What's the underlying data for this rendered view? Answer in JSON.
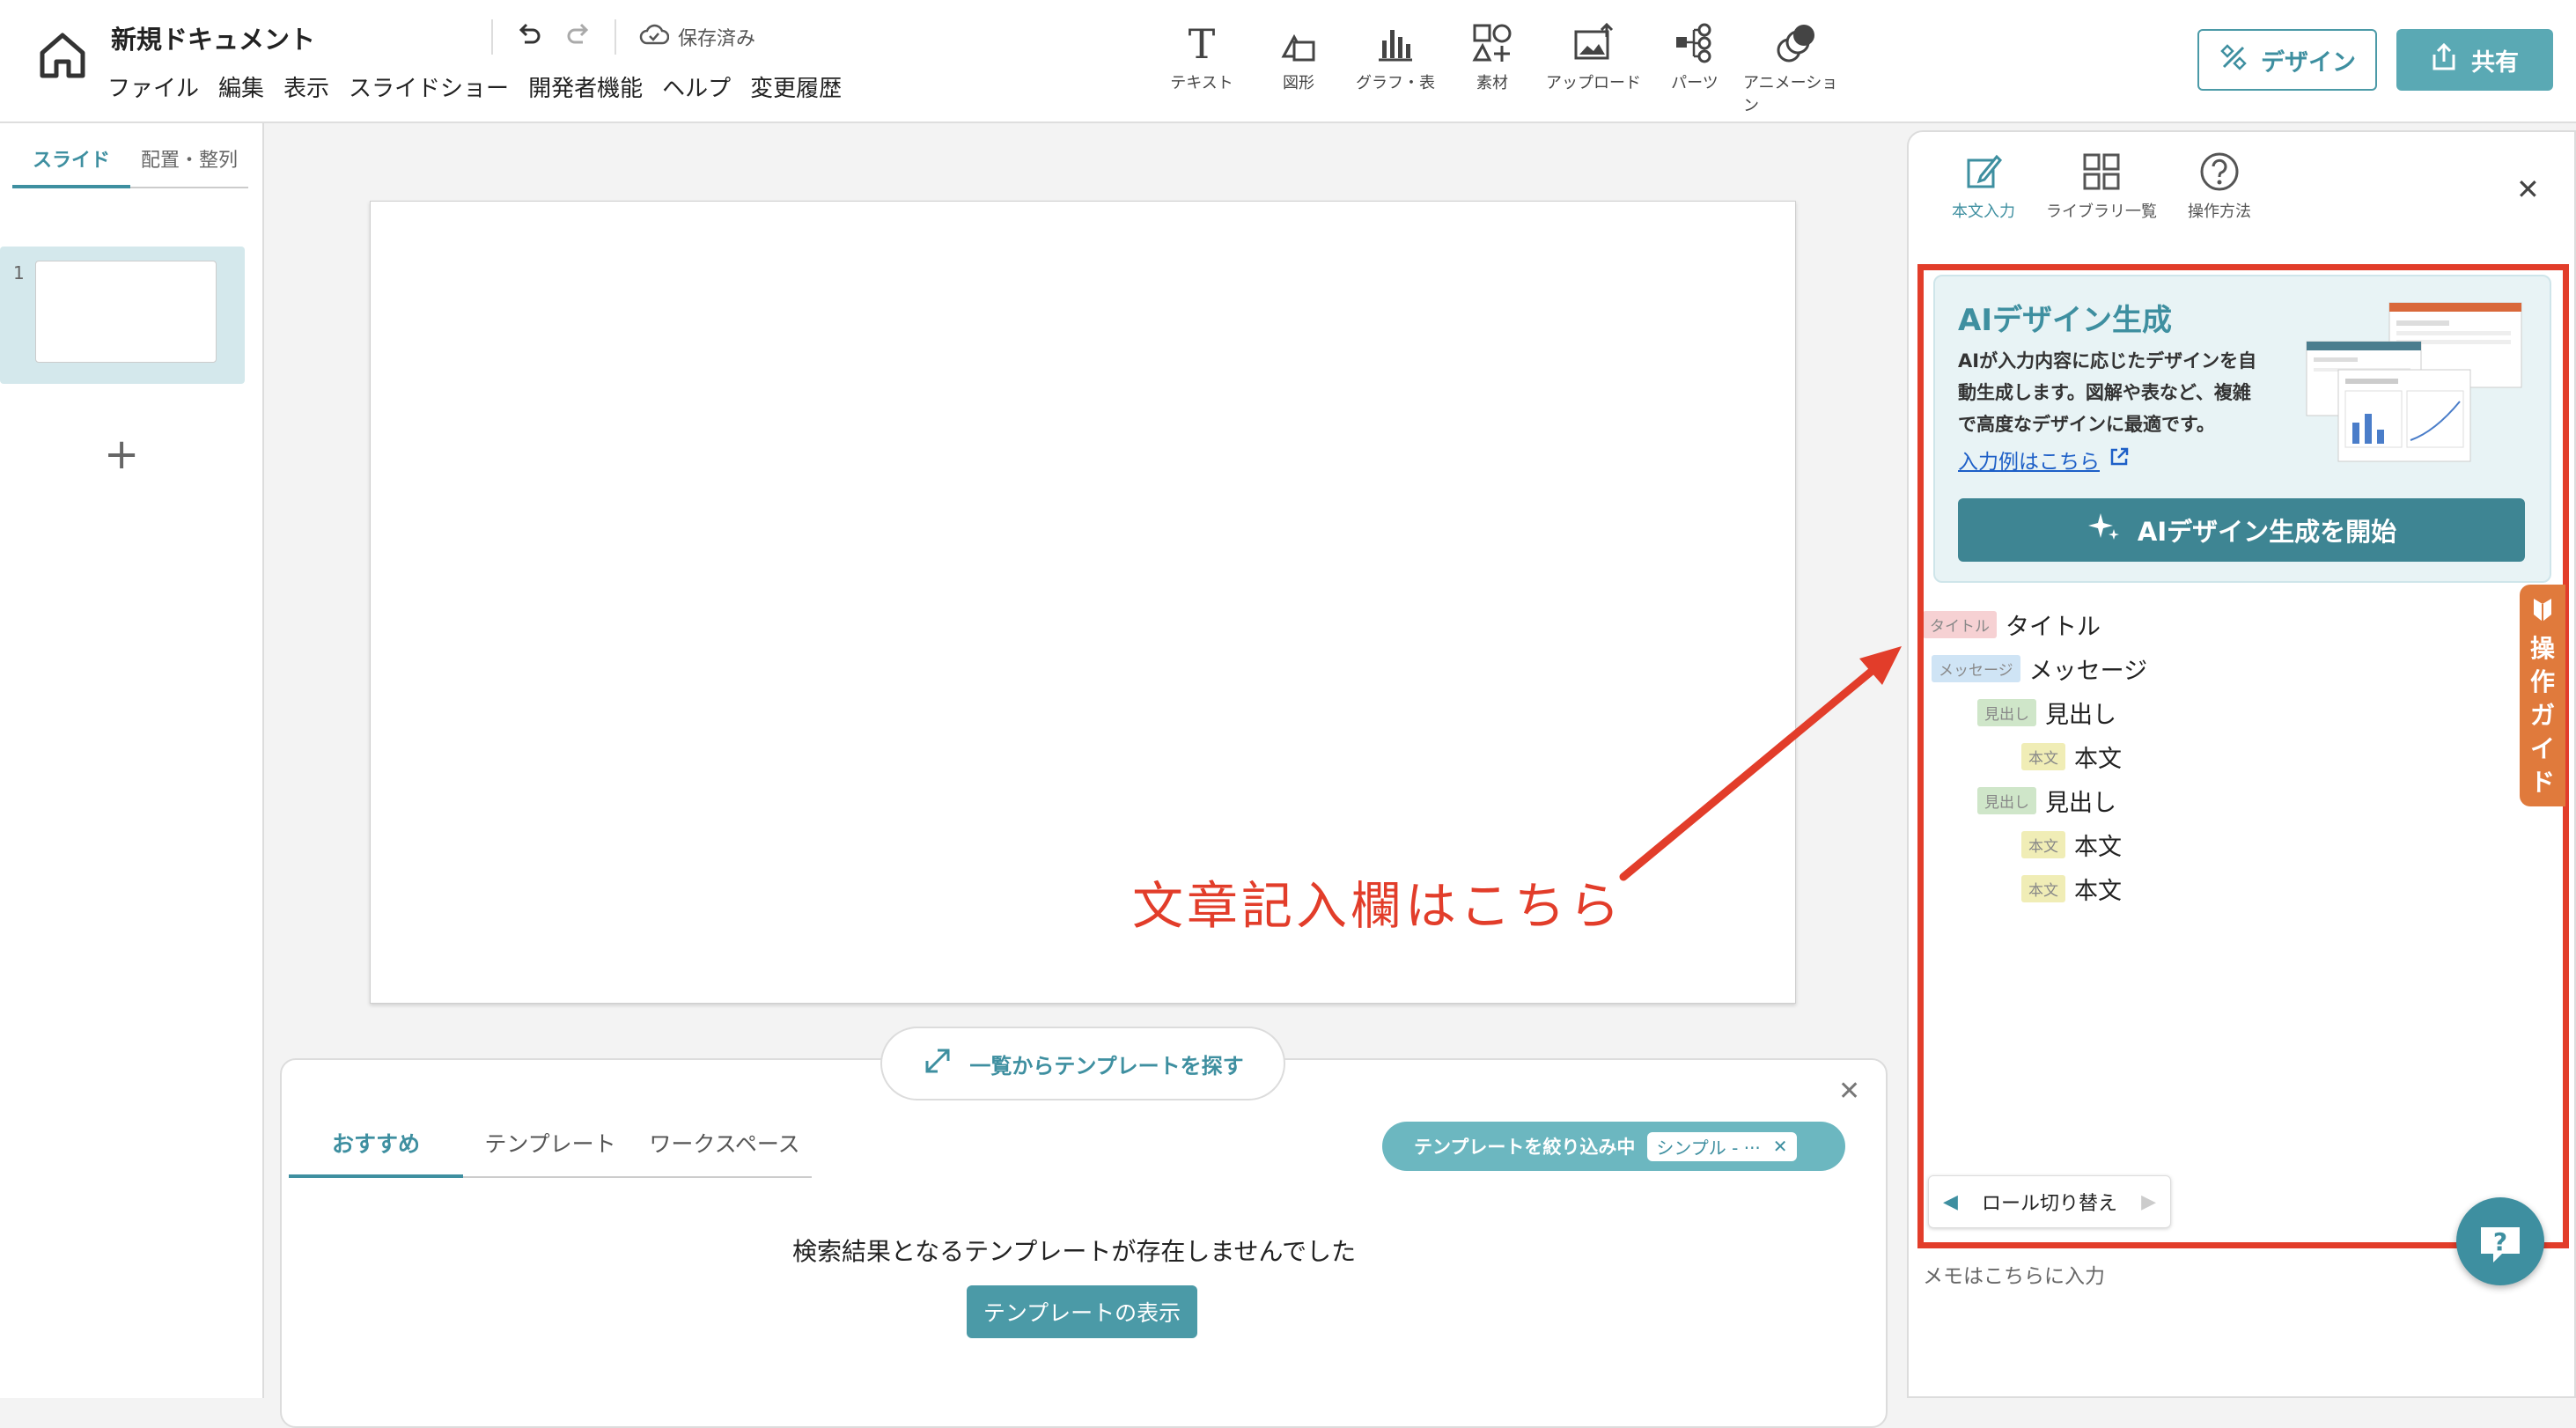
{
  "header": {
    "doc_title": "新規ドキュメント",
    "save_status": "保存済み",
    "menu": [
      "ファイル",
      "編集",
      "表示",
      "スライドショー",
      "開発者機能",
      "ヘルプ",
      "変更履歴"
    ],
    "tools": [
      {
        "label": "テキスト",
        "icon": "text-icon"
      },
      {
        "label": "図形",
        "icon": "shape-icon"
      },
      {
        "label": "グラフ・表",
        "icon": "chart-icon"
      },
      {
        "label": "素材",
        "icon": "material-icon"
      },
      {
        "label": "アップロード",
        "icon": "upload-image-icon"
      },
      {
        "label": "パーツ",
        "icon": "parts-icon"
      },
      {
        "label": "アニメーション",
        "icon": "animation-icon"
      }
    ],
    "design_label": "デザイン",
    "share_label": "共有"
  },
  "left_panel": {
    "tabs": [
      "スライド",
      "配置・整列"
    ],
    "active_tab": "スライド",
    "slide_number": "1",
    "add_label": "+"
  },
  "template_panel": {
    "browse_label": "一覧からテンプレートを探す",
    "tabs": [
      "おすすめ",
      "テンプレート",
      "ワークスペース"
    ],
    "active_tab": "おすすめ",
    "filter_label": "テンプレートを絞り込み中",
    "filter_value": "シンプル - ···",
    "no_result": "検索結果となるテンプレートが存在しませんでした",
    "show_button": "テンプレートの表示"
  },
  "right_panel": {
    "tabs": [
      {
        "label": "本文入力",
        "icon": "edit-icon"
      },
      {
        "label": "ライブラリ一覧",
        "icon": "grid-icon"
      },
      {
        "label": "操作方法",
        "icon": "help-icon"
      }
    ],
    "ai": {
      "title": "AIデザイン生成",
      "desc_lines": [
        "AIが入力内容に応じたデザインを自",
        "動生成します。図解や表など、複雑",
        "で高度なデザインに最適です。"
      ],
      "link": "入力例はこちら",
      "start_button": "AIデザイン生成を開始"
    },
    "roles": [
      {
        "tag": "タイトル",
        "text": "タイトル",
        "kind": "t"
      },
      {
        "tag": "メッセージ",
        "text": "メッセージ",
        "kind": "m"
      },
      {
        "tag": "見出し",
        "text": "見出し",
        "kind": "h"
      },
      {
        "tag": "本文",
        "text": "本文",
        "kind": "b"
      },
      {
        "tag": "見出し",
        "text": "見出し",
        "kind": "h"
      },
      {
        "tag": "本文",
        "text": "本文",
        "kind": "b"
      },
      {
        "tag": "本文",
        "text": "本文",
        "kind": "b"
      }
    ],
    "role_switch": "ロール切り替え",
    "memo_placeholder": "メモはこちらに入力",
    "guide_tab_chars": [
      "操",
      "作",
      "ガ",
      "イ",
      "ド"
    ]
  },
  "annotation": "文章記入欄はこちら",
  "colors": {
    "accent": "#3e8fa0",
    "annotation": "#e23d2a",
    "guide": "#e07a3c"
  }
}
